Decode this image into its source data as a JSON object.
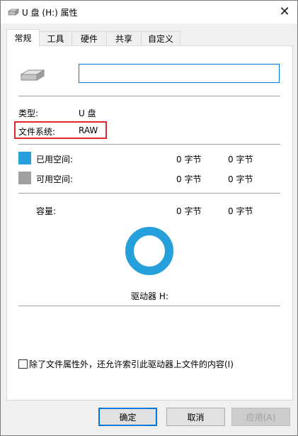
{
  "window": {
    "title": "U 盘 (H:) 属性",
    "close_glyph": "✕"
  },
  "tabs": [
    {
      "label": "常规",
      "active": true
    },
    {
      "label": "工具"
    },
    {
      "label": "硬件"
    },
    {
      "label": "共享"
    },
    {
      "label": "自定义"
    }
  ],
  "general": {
    "name_value": "",
    "type_label": "类型:",
    "type_value": "U 盘",
    "fs_label": "文件系统:",
    "fs_value": "RAW",
    "used_label": "已用空间:",
    "used_bytes": "0 字节",
    "used_size": "0 字节",
    "free_label": "可用空间:",
    "free_bytes": "0 字节",
    "free_size": "0 字节",
    "capacity_label": "容量:",
    "capacity_bytes": "0 字节",
    "capacity_size": "0 字节",
    "drive_label": "驱动器 H:",
    "index_checkbox_label": "除了文件属性外，还允许索引此驱动器上文件的内容(I)",
    "index_checked": false
  },
  "colors": {
    "used": "#26a0da",
    "free": "#a0a0a0",
    "donut": "#26a0da",
    "highlight": "#e0262e"
  },
  "buttons": {
    "ok": "确定",
    "cancel": "取消",
    "apply": "应用(A)"
  }
}
